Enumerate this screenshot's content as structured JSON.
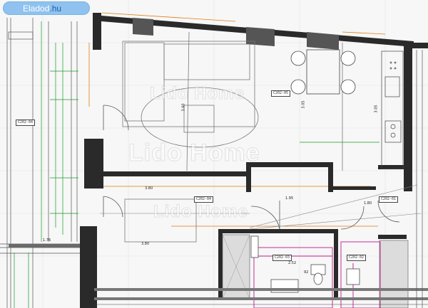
{
  "site": {
    "name_part1": "Eladod",
    "name_part2": ".hu"
  },
  "watermark": {
    "text": "Lido Home"
  },
  "rooms": [
    {
      "id": "C202-05"
    },
    {
      "id": "C202-04"
    },
    {
      "id": "C202-01"
    },
    {
      "id": "C202-03"
    },
    {
      "id": "C202-02"
    },
    {
      "id": "C202-04b",
      "text": "C202-04"
    }
  ],
  "dimensions": {
    "d1": "3.80",
    "d2": "3.80",
    "d3": "1.95",
    "d4": "1.80",
    "d5": "2.52",
    "d6": "3.60",
    "d7": "3.05",
    "d8": "3.05",
    "d9": "92",
    "d10": "1.76"
  },
  "colors": {
    "badge": "#8fc2ef",
    "wall": "#222222",
    "green_dim": "#1a9a2a",
    "orange_dim": "#e07a10",
    "pink": "#c2188f"
  }
}
